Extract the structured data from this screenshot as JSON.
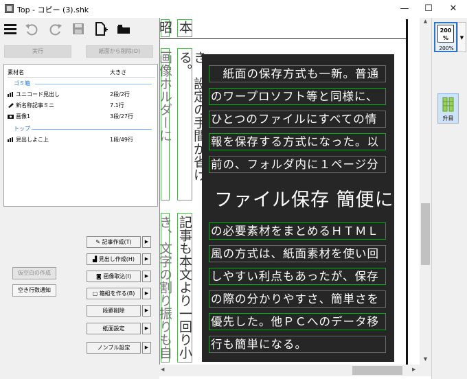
{
  "window": {
    "title": "Top - コピー (3).shk",
    "minimize": "—",
    "maximize": "☐",
    "close": "✕"
  },
  "toolbar": {
    "icons": [
      "menu-icon",
      "undo-icon",
      "redo-icon",
      "save-icon",
      "new-file-icon",
      "folder-icon"
    ]
  },
  "buttons": {
    "run": "実行",
    "delete_from_page": "紙面から削除(D)"
  },
  "materials": {
    "col_name": "素材名",
    "col_size": "大きさ",
    "group_trash": "ゴミ箱",
    "group_top": "トップ",
    "items": [
      {
        "name": "ユニコード見出し",
        "size": "2段/2行"
      },
      {
        "name": "新名称記事ミニ",
        "size": "7.1行"
      },
      {
        "name": "画像1",
        "size": "3段/27行"
      },
      {
        "name": "見出しよこ上",
        "size": "1段/49行"
      }
    ]
  },
  "commands": {
    "write_article": "記事作成(T)",
    "write_heading": "見出し作成(H)",
    "import_image": "画像取込(I)",
    "make_box": "箱組を作る(B)",
    "delete_column": "段罫削除",
    "page_settings": "紙面設定",
    "nombre_settings": "ノンブル設定",
    "arrow": "▶",
    "create_placeholder": "仮空白の作成",
    "notify_blank_lines": "空き行数通知"
  },
  "canvas": {
    "vertical_top": [
      "昭",
      "本"
    ],
    "vertical_mid": [
      "画像ホルダーに",
      "き、設定の手間が省ける。"
    ],
    "vertical_bottom": [
      "き、文字の割り振りも自",
      "記事も本文より一回り小"
    ],
    "lines_top": [
      "　紙面の保存方式も一新。普通",
      "のワープロソフト等と同様に、",
      "ひとつのファイルにすべての情",
      "報を保存する方式になった。以",
      "前の、フォルダ内に１ページ分"
    ],
    "heading": "ファイル保存 簡便に",
    "lines_bottom": [
      "の必要素材をまとめるＨＴＭＬ",
      "風の方式は、紙面素材を使い回",
      "しやすい利点もあったが、保存",
      "の際の分かりやすさ、簡単さを",
      "優先した。他ＰＣへのデータ移",
      "行も簡単になる。"
    ]
  },
  "right_panel": {
    "zoom_box": "200\n%",
    "zoom_label": "200%",
    "mode_label": "升目"
  },
  "scroll": {
    "up": "▲",
    "down": "▼",
    "left": "◀",
    "right": "▶"
  }
}
